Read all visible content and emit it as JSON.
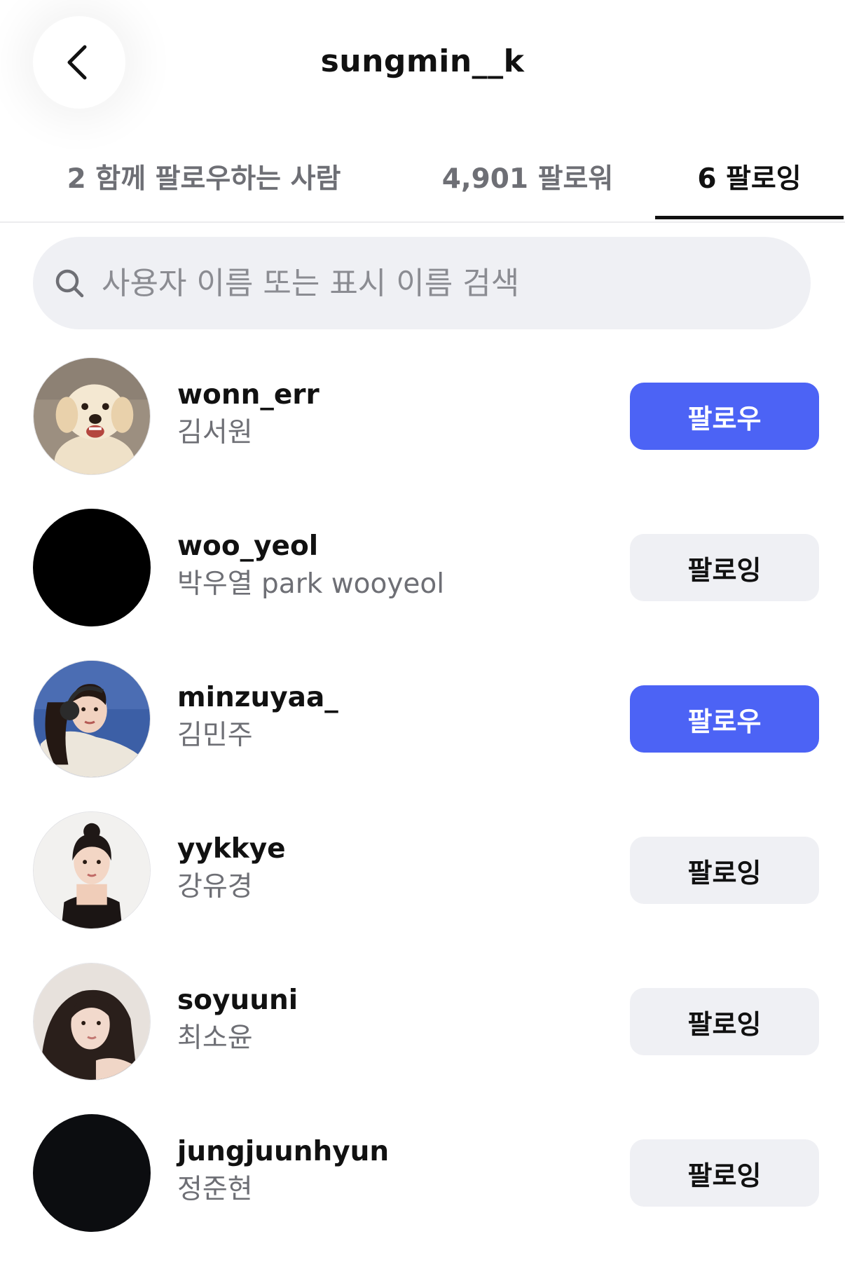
{
  "header": {
    "title": "sungmin__k",
    "back_icon": "chevron-left-icon"
  },
  "tabs": [
    {
      "label": "2 함께 팔로우하는 사람",
      "active": false
    },
    {
      "label": "4,901 팔로워",
      "active": false
    },
    {
      "label": "6 팔로잉",
      "active": true
    }
  ],
  "search": {
    "placeholder": "사용자 이름 또는 표시 이름 검색",
    "value": "",
    "icon": "search-icon"
  },
  "users": [
    {
      "username": "wonn_err",
      "display_name": "김서원",
      "button_label": "팔로우",
      "button_state": "follow",
      "avatar": "puppy-photo"
    },
    {
      "username": "woo_yeol",
      "display_name": "박우열 park wooyeol",
      "button_label": "팔로잉",
      "button_state": "following",
      "avatar": "black-photo"
    },
    {
      "username": "minzuyaa_",
      "display_name": "김민주",
      "button_label": "팔로우",
      "button_state": "follow",
      "avatar": "headphones-selfie-photo"
    },
    {
      "username": "yykkye",
      "display_name": "강유경",
      "button_label": "팔로잉",
      "button_state": "following",
      "avatar": "portrait-photo"
    },
    {
      "username": "soyuuni",
      "display_name": "최소윤",
      "button_label": "팔로잉",
      "button_state": "following",
      "avatar": "portrait-photo"
    },
    {
      "username": "jungjuunhyun",
      "display_name": "정준현",
      "button_label": "팔로잉",
      "button_state": "following",
      "avatar": "black-photo"
    }
  ],
  "colors": {
    "accent": "#4c63f5",
    "following_bg": "#eff0f4",
    "secondary_text": "#6e6f75",
    "primary_text": "#111111"
  }
}
